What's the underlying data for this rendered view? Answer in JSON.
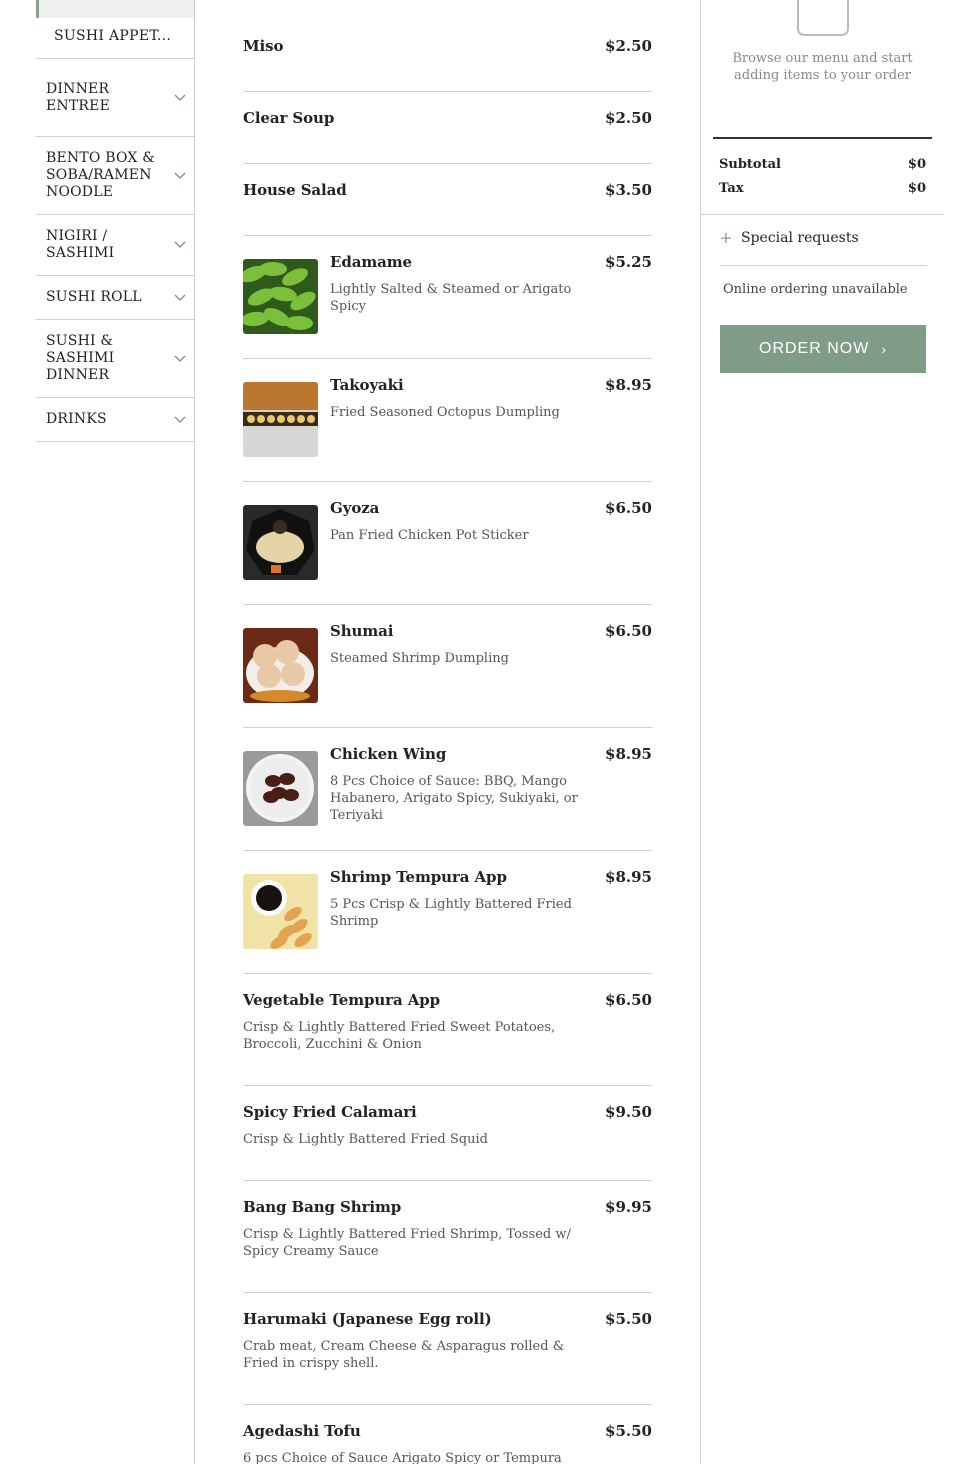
{
  "nav": {
    "active_sub": "SUSHI APPET...",
    "items": [
      {
        "label": "DINNER ENTREE"
      },
      {
        "label": "BENTO BOX & SOBA/RAMEN NOODLE"
      },
      {
        "label": "NIGIRI / SASHIMI"
      },
      {
        "label": "SUSHI ROLL"
      },
      {
        "label": "SUSHI & SASHIMI DINNER"
      },
      {
        "label": "DRINKS"
      }
    ]
  },
  "menu": {
    "items": [
      {
        "name": "Miso",
        "price": "$2.50",
        "desc": "",
        "image": ""
      },
      {
        "name": "Clear Soup",
        "price": "$2.50",
        "desc": "",
        "image": ""
      },
      {
        "name": "House Salad",
        "price": "$3.50",
        "desc": "",
        "image": ""
      },
      {
        "name": "Edamame",
        "price": "$5.25",
        "desc": "Lightly Salted & Steamed or Arigato Spicy",
        "image": "edamame-photo"
      },
      {
        "name": "Takoyaki",
        "price": "$8.95",
        "desc": "Fried Seasoned Octopus Dumpling",
        "image": "takoyaki-photo"
      },
      {
        "name": "Gyoza",
        "price": "$6.50",
        "desc": "Pan Fried Chicken Pot Sticker",
        "image": "gyoza-photo"
      },
      {
        "name": "Shumai",
        "price": "$6.50",
        "desc": "Steamed Shrimp Dumpling",
        "image": "shumai-photo"
      },
      {
        "name": "Chicken Wing",
        "price": "$8.95",
        "desc": "8 Pcs Choice of Sauce: BBQ, Mango Habanero, Arigato Spicy, Sukiyaki, or Teriyaki",
        "image": "chicken-wing-photo"
      },
      {
        "name": "Shrimp Tempura App",
        "price": "$8.95",
        "desc": "5 Pcs Crisp & Lightly Battered Fried Shrimp",
        "image": "shrimp-tempura-photo"
      },
      {
        "name": "Vegetable Tempura App",
        "price": "$6.50",
        "desc": "Crisp & Lightly Battered Fried Sweet Potatoes, Broccoli, Zucchini & Onion",
        "image": ""
      },
      {
        "name": "Spicy Fried Calamari",
        "price": "$9.50",
        "desc": "Crisp & Lightly Battered Fried Squid",
        "image": ""
      },
      {
        "name": "Bang Bang Shrimp",
        "price": "$9.95",
        "desc": "Crisp & Lightly Battered Fried Shrimp, Tossed w/ Spicy Creamy Sauce",
        "image": ""
      },
      {
        "name": "Harumaki (Japanese Egg roll)",
        "price": "$5.50",
        "desc": "Crab meat, Cream Cheese & Asparagus rolled & Fried in crispy shell.",
        "image": ""
      },
      {
        "name": "Agedashi Tofu",
        "price": "$5.50",
        "desc": "6 pcs Choice of Sauce Arigato Spicy or Tempura",
        "image": ""
      }
    ]
  },
  "cart": {
    "browse_text": "Browse our menu and start adding items to your order",
    "subtotal_label": "Subtotal",
    "subtotal_value": "$0",
    "tax_label": "Tax",
    "tax_value": "$0",
    "special_requests": "Special requests",
    "unavailable": "Online ordering unavailable",
    "order_button": "ORDER NOW",
    "accent": "#7f9c89"
  }
}
